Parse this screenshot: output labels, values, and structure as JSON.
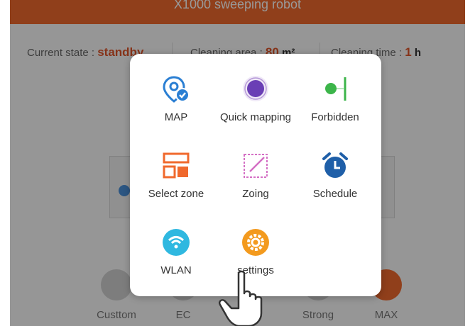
{
  "app": {
    "title": "X1000 sweeping robot"
  },
  "status": {
    "state_label": "Current state :",
    "state_value": "standby",
    "area_label": "Cleaning area :",
    "area_value": "80",
    "area_unit": "m²",
    "time_label": "Cleaning time :",
    "time_value": "1",
    "time_unit": "h"
  },
  "modes": [
    {
      "label": "Custtom",
      "icon": "mountain-icon",
      "active": false
    },
    {
      "label": "EC",
      "icon": "ec-icon",
      "active": false
    },
    {
      "label": "Strong",
      "icon": "fan-icon",
      "active": false
    },
    {
      "label": "MAX",
      "icon": "fan-icon",
      "active": true
    }
  ],
  "menu": {
    "items": [
      {
        "label": "MAP",
        "icon": "map-pin-check-icon"
      },
      {
        "label": "Quick mapping",
        "icon": "radar-circle-icon"
      },
      {
        "label": "Forbidden",
        "icon": "virtual-wall-icon"
      },
      {
        "label": "Select zone",
        "icon": "zone-select-icon"
      },
      {
        "label": "Zoing",
        "icon": "zoning-icon"
      },
      {
        "label": "Schedule",
        "icon": "alarm-clock-icon"
      },
      {
        "label": "WLAN",
        "icon": "wifi-icon"
      },
      {
        "label": "settings",
        "icon": "gear-icon"
      }
    ]
  },
  "colors": {
    "accent": "#f0692d",
    "blue": "#2b7fd3",
    "purple": "#6a3fb5",
    "green": "#3cb54a",
    "teal": "#2fb8e0",
    "orange": "#f39a1e"
  }
}
